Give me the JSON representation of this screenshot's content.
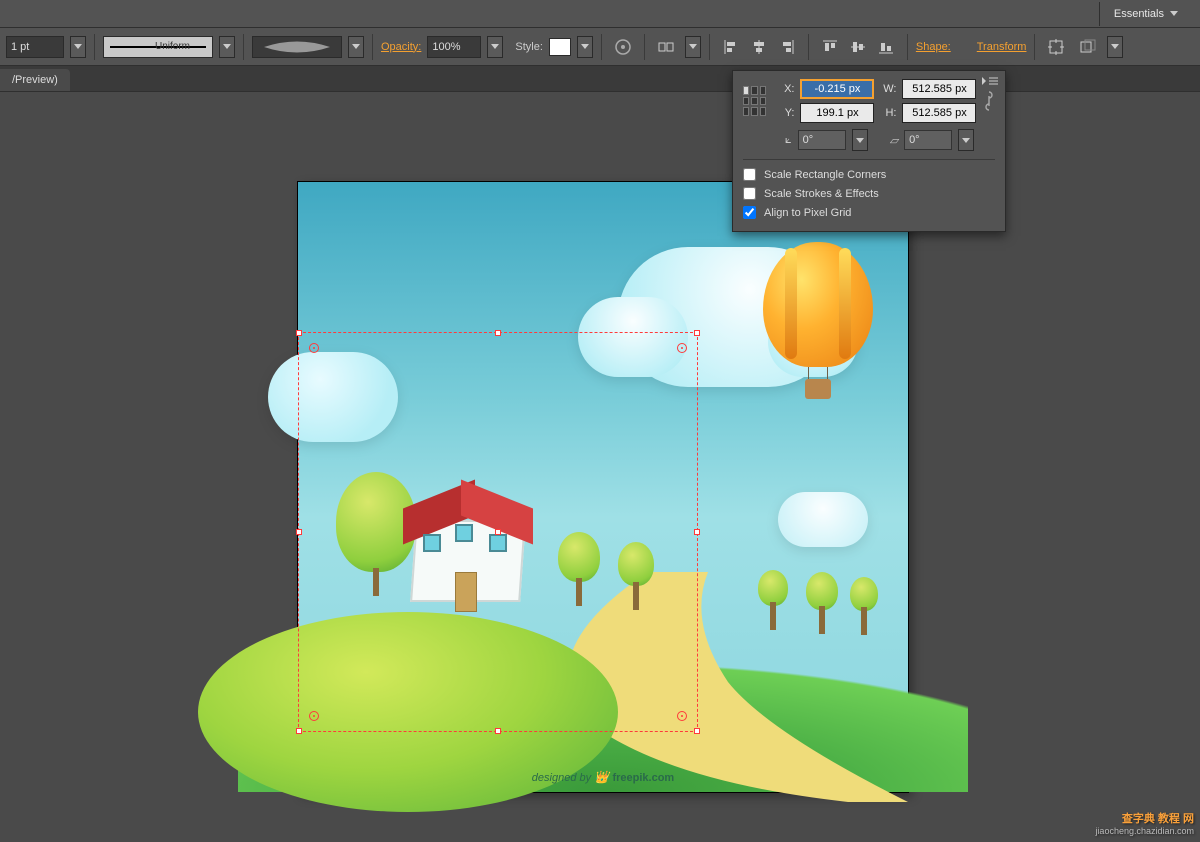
{
  "menubar": {
    "workspace": "Essentials"
  },
  "controlbar": {
    "stroke_weight": "1 pt",
    "stroke_style_label": "Uniform",
    "opacity_label": "Opacity:",
    "opacity_value": "100%",
    "style_label": "Style:",
    "shape_label": "Shape:",
    "transform_label": "Transform"
  },
  "tab": {
    "title": "/Preview)"
  },
  "transform_panel": {
    "x_label": "X:",
    "x_value": "-0.215 px",
    "y_label": "Y:",
    "y_value": "199.1 px",
    "w_label": "W:",
    "w_value": "512.585 px",
    "h_label": "H:",
    "h_value": "512.585 px",
    "rotate_value": "0°",
    "shear_value": "0°",
    "scale_corners": "Scale Rectangle Corners",
    "scale_strokes": "Scale Strokes & Effects",
    "align_pixel": "Align to Pixel Grid",
    "align_pixel_checked": true
  },
  "artboard": {
    "credit_prefix": "designed by ",
    "credit_brand": "freepik.com"
  },
  "watermark": {
    "line1": "查字典  教程 网",
    "line2": "jiaocheng.chazidian.com"
  }
}
